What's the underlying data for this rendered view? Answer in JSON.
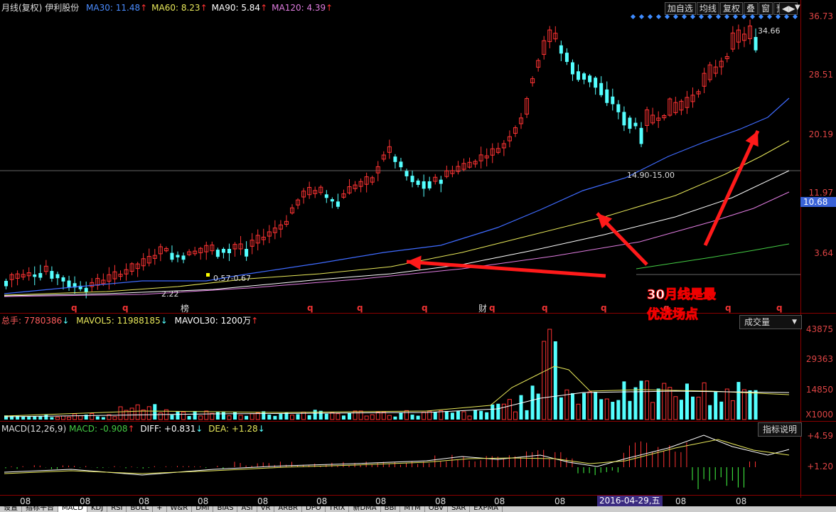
{
  "header": {
    "period": "月线(复权)",
    "stock": "伊利股份",
    "ma": [
      {
        "label": "MA30: 11.48",
        "color": "#4a8cff",
        "arrow": "↑"
      },
      {
        "label": "MA60: 8.23",
        "color": "#e8e85a",
        "arrow": "↑"
      },
      {
        "label": "MA90: 5.84",
        "color": "#ffffff",
        "arrow": "↑"
      },
      {
        "label": "MA120: 4.39",
        "color": "#e07ce0",
        "arrow": "↑"
      }
    ]
  },
  "toolbar": [
    "加自选",
    "均线",
    "复权",
    "叠",
    "窗",
    "预测"
  ],
  "price_axis": [
    "36.73",
    "28.51",
    "20.19",
    "11.97",
    "10.68",
    "3.64"
  ],
  "annotations": {
    "high_label": "34.66",
    "mid_label": "14.90-15.00",
    "low_label1": "0.57-0.67",
    "low_label2": "2.22",
    "bang": "榜",
    "cai": "财",
    "callout_line1": "30月线是最",
    "callout_line2": "优进场点"
  },
  "volume": {
    "header_total": "总手: 7780386",
    "header_mavol5": "MAVOL5: 11988185",
    "header_mavol30": "MAVOL30: 1200万",
    "arrow_down": "↓",
    "arrow_up": "↑",
    "dropdown": "成交量",
    "axis": [
      "43875",
      "29363",
      "14850",
      "X1000"
    ]
  },
  "macd": {
    "header_name": "MACD(12,26,9)",
    "header_macd": "MACD: -0.908",
    "header_diff": "DIFF: +0.831",
    "header_dea": "DEA: +1.28",
    "arrow_up": "↑",
    "arrow_down": "↓",
    "button": "指标说明",
    "axis": [
      "+4.59",
      "+1.20"
    ]
  },
  "time_axis": [
    "08",
    "08",
    "08",
    "08",
    "08",
    "08",
    "08",
    "08",
    "08",
    "08",
    "08",
    "08",
    "08"
  ],
  "date_highlight": "2016-04-29,五",
  "bottom_tabs": [
    "设置",
    "指标平台",
    "MACD",
    "KDJ",
    "RSI",
    "BOLL",
    "+",
    "W&R",
    "DMI",
    "BIAS",
    "ASI",
    "VR",
    "ARBR",
    "DPO",
    "TRIX",
    "新DMA",
    "BBI",
    "MTM",
    "OBV",
    "SAR",
    "EXPMA"
  ],
  "q_marks": [
    "q",
    "q",
    "q",
    "q",
    "q",
    "q",
    "q",
    "q",
    "q",
    "q",
    "q",
    "q"
  ],
  "colors": {
    "up": "#ff3333",
    "down": "#54ffff",
    "ma30": "#3f6bff",
    "ma60": "#e8e85a",
    "ma90": "#ffffff",
    "ma120": "#e07ce0",
    "ma250": "#44cc44"
  }
}
